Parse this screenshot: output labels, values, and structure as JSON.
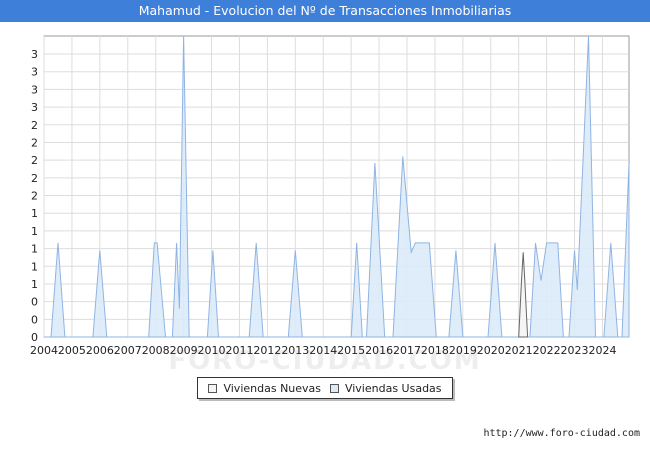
{
  "chart_data": {
    "type": "area",
    "title": "Mahamud - Evolucion del Nº de Transacciones Inmobiliarias",
    "xlabel": "",
    "ylabel": "",
    "x_tick_labels": [
      "2004",
      "2005",
      "2006",
      "2007",
      "2008",
      "2009",
      "2010",
      "2011",
      "2012",
      "2013",
      "2014",
      "2015",
      "2016",
      "2017",
      "2018",
      "2019",
      "2020",
      "2021",
      "2022",
      "2023",
      "2024"
    ],
    "y_tick_labels": [
      "0",
      "0",
      "0",
      "1",
      "1",
      "1",
      "1",
      "1",
      "2",
      "2",
      "2",
      "2",
      "2",
      "3",
      "3",
      "3",
      "3"
    ],
    "ylim": [
      0,
      3.2
    ],
    "xlim": [
      2004.0,
      2024.95
    ],
    "grid": true,
    "legend_position": "bottom",
    "series": [
      {
        "name": "Viviendas Nuevas",
        "fill": "#f4f4f4",
        "stroke": "#666666",
        "points": [
          [
            2021.0,
            0
          ],
          [
            2021.1,
            0.6
          ],
          [
            2021.16,
            0.9
          ],
          [
            2021.22,
            0.6
          ],
          [
            2021.32,
            0
          ]
        ]
      },
      {
        "name": "Viviendas Usadas",
        "fill": "#dcebfa",
        "stroke": "#8fb4e3",
        "points": [
          [
            2004.0,
            0
          ],
          [
            2004.25,
            0
          ],
          [
            2004.5,
            1.0
          ],
          [
            2004.75,
            0
          ],
          [
            2005.75,
            0
          ],
          [
            2006.0,
            0.92
          ],
          [
            2006.25,
            0
          ],
          [
            2007.75,
            0
          ],
          [
            2007.95,
            1.0
          ],
          [
            2008.05,
            1.0
          ],
          [
            2008.35,
            0
          ],
          [
            2008.6,
            0
          ],
          [
            2008.75,
            1.0
          ],
          [
            2008.85,
            0.3
          ],
          [
            2009.0,
            3.2
          ],
          [
            2009.2,
            0
          ],
          [
            2009.85,
            0
          ],
          [
            2010.05,
            0.92
          ],
          [
            2010.25,
            0
          ],
          [
            2011.35,
            0
          ],
          [
            2011.6,
            1.0
          ],
          [
            2011.85,
            0
          ],
          [
            2012.75,
            0
          ],
          [
            2013.0,
            0.92
          ],
          [
            2013.25,
            0
          ],
          [
            2015.0,
            0
          ],
          [
            2015.2,
            1.0
          ],
          [
            2015.4,
            0
          ],
          [
            2015.55,
            0
          ],
          [
            2015.85,
            1.85
          ],
          [
            2016.2,
            0
          ],
          [
            2016.5,
            0
          ],
          [
            2016.85,
            1.92
          ],
          [
            2017.15,
            0.9
          ],
          [
            2017.3,
            1.0
          ],
          [
            2017.8,
            1.0
          ],
          [
            2018.05,
            0
          ],
          [
            2018.5,
            0
          ],
          [
            2018.75,
            0.92
          ],
          [
            2019.0,
            0
          ],
          [
            2019.9,
            0
          ],
          [
            2020.15,
            1.0
          ],
          [
            2020.4,
            0
          ],
          [
            2021.4,
            0
          ],
          [
            2021.6,
            1.0
          ],
          [
            2021.8,
            0.6
          ],
          [
            2022.0,
            1.0
          ],
          [
            2022.4,
            1.0
          ],
          [
            2022.6,
            0
          ],
          [
            2022.8,
            0
          ],
          [
            2023.0,
            0.92
          ],
          [
            2023.1,
            0.5
          ],
          [
            2023.5,
            3.2
          ],
          [
            2023.75,
            0
          ],
          [
            2024.05,
            0
          ],
          [
            2024.3,
            1.0
          ],
          [
            2024.55,
            0
          ],
          [
            2024.7,
            0
          ],
          [
            2024.95,
            1.85
          ],
          [
            2024.95,
            0
          ]
        ]
      }
    ]
  },
  "legend": {
    "nuevas_label": "Viviendas Nuevas",
    "usadas_label": "Viviendas Usadas",
    "nuevas_color": "#f4f4f4",
    "usadas_color": "#dcebfa"
  },
  "footer": {
    "source_url": "http://www.foro-ciudad.com"
  },
  "watermark": {
    "text": "FORO-CIUDAD.COM"
  }
}
